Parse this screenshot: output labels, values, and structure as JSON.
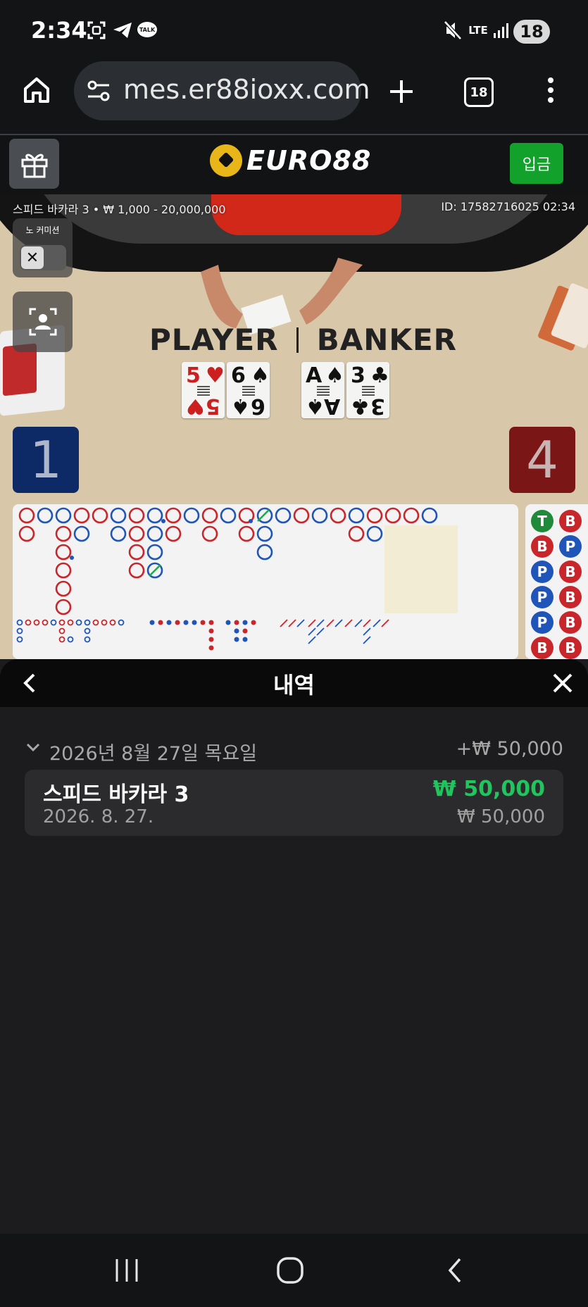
{
  "status_bar": {
    "time": "2:34",
    "battery": "18",
    "network": "LTE",
    "icons": [
      "screenshot-icon",
      "telegram-icon",
      "kakaotalk-icon",
      "mute-icon",
      "signal-icon"
    ]
  },
  "browser": {
    "url": "mes.er88ioxx.com",
    "tab_count": "18"
  },
  "site": {
    "logo_text": "EURO88",
    "deposit_label": "입금"
  },
  "game": {
    "info": "스피드 바카라 3 • ₩ 1,000 - 20,000,000",
    "id": "ID: 17582716025 02:34",
    "no_commission_label": "노 커미션",
    "player_label": "PLAYER",
    "banker_label": "BANKER",
    "player_score": "1",
    "banker_score": "4",
    "player_cards": [
      {
        "rank": "5",
        "suit": "♥"
      },
      {
        "rank": "6",
        "suit": "♠"
      }
    ],
    "banker_cards": [
      {
        "rank": "A",
        "suit": "♠"
      },
      {
        "rank": "3",
        "suit": "♣"
      }
    ],
    "bead_road": [
      {
        "label": "T",
        "color": "#1f8a3a"
      },
      {
        "label": "B",
        "color": "#c9262b"
      },
      {
        "label": "B",
        "color": "#c9262b"
      },
      {
        "label": "P",
        "color": "#1f54b8"
      },
      {
        "label": "P",
        "color": "#1f54b8"
      },
      {
        "label": "B",
        "color": "#c9262b"
      },
      {
        "label": "P",
        "color": "#1f54b8"
      },
      {
        "label": "B",
        "color": "#c9262b"
      },
      {
        "label": "P",
        "color": "#1f54b8"
      },
      {
        "label": "B",
        "color": "#c9262b"
      },
      {
        "label": "B",
        "color": "#c9262b"
      },
      {
        "label": "B",
        "color": "#c9262b"
      }
    ]
  },
  "history": {
    "title": "내역",
    "date_header": "2026년 8월 27일 목요일",
    "date_total": "+₩ 50,000",
    "transactions": [
      {
        "name": "스피드 바카라 3",
        "date": "2026. 8. 27.",
        "amount": "₩ 50,000",
        "bet": "₩ 50,000"
      }
    ]
  },
  "colors": {
    "win_green": "#21c55d",
    "deposit_green": "#12a12a",
    "logo_gold": "#e8b619",
    "player_blue": "#1f54b8",
    "banker_red": "#c9262b"
  }
}
